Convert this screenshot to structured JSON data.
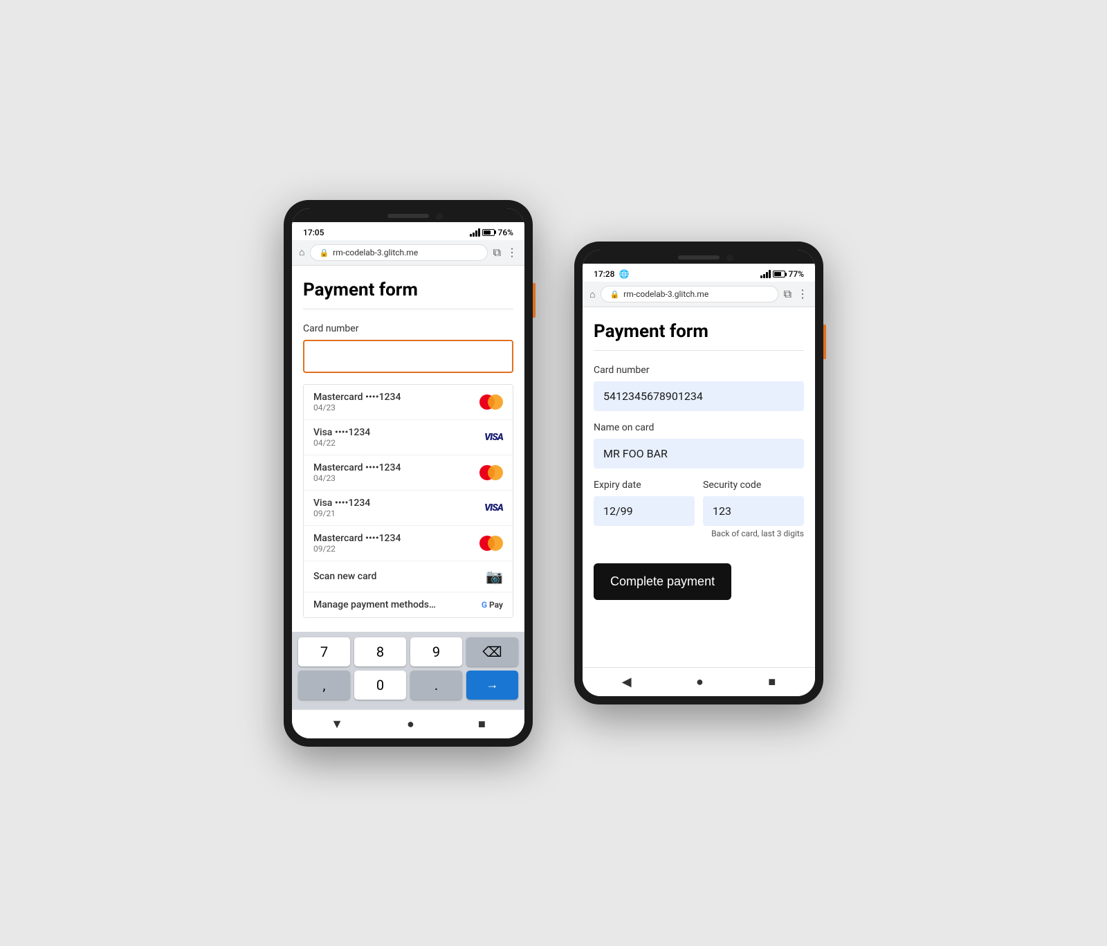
{
  "phone_left": {
    "time": "17:05",
    "battery": "76%",
    "url": "rm-codelab-3.glitch.me",
    "page_title": "Payment form",
    "card_number_label": "Card number",
    "card_input_placeholder": "",
    "autocomplete_items": [
      {
        "brand": "Mastercard",
        "dots": "••••",
        "last4": "1234",
        "expiry": "04/23",
        "type": "mastercard"
      },
      {
        "brand": "Visa",
        "dots": "••••",
        "last4": "1234",
        "expiry": "04/22",
        "type": "visa"
      },
      {
        "brand": "Mastercard",
        "dots": "••••",
        "last4": "1234",
        "expiry": "04/23",
        "type": "mastercard"
      },
      {
        "brand": "Visa",
        "dots": "••••",
        "last4": "1234",
        "expiry": "09/21",
        "type": "visa"
      },
      {
        "brand": "Mastercard",
        "dots": "••••",
        "last4": "1234",
        "expiry": "09/22",
        "type": "mastercard"
      }
    ],
    "scan_new_card": "Scan new card",
    "manage_payment": "Manage payment methods…",
    "keyboard": {
      "row1": [
        "7",
        "8",
        "9"
      ],
      "row2": [
        ",",
        "0",
        "."
      ],
      "backspace": "⌫",
      "next_arrow": "→"
    }
  },
  "phone_right": {
    "time": "17:28",
    "battery": "77%",
    "url": "rm-codelab-3.glitch.me",
    "page_title": "Payment form",
    "card_number_label": "Card number",
    "card_number_value": "5412345678901234",
    "name_label": "Name on card",
    "name_value": "MR FOO BAR",
    "expiry_label": "Expiry date",
    "expiry_value": "12/99",
    "security_label": "Security code",
    "security_value": "123",
    "security_hint": "Back of card, last 3 digits",
    "complete_btn": "Complete payment"
  }
}
